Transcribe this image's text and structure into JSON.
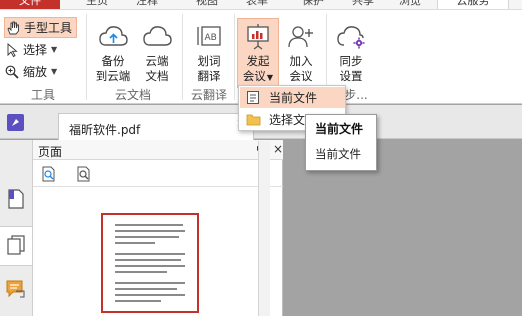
{
  "menu_tabs": {
    "file": "文件",
    "home": "主页",
    "comment": "注释",
    "view": "视图",
    "form": "表单",
    "protect": "保护",
    "share": "共享",
    "browse": "浏览",
    "cloud": "云服务"
  },
  "ribbon": {
    "hand_tool": "手型工具",
    "select": "选择",
    "zoom": "缩放",
    "tools_group": "工具",
    "backup_line1": "备份",
    "backup_line2": "到云端",
    "cloud_doc_line1": "云端",
    "cloud_doc_line2": "文档",
    "cloud_docs_group": "云文档",
    "translate_line1": "划词",
    "translate_line2": "翻译",
    "translate_group": "云翻译",
    "meeting_line1": "发起",
    "meeting_line2": "会议",
    "join_line1": "加入",
    "join_line2": "会议",
    "sync_line1": "同步",
    "sync_line2": "设置",
    "sync_group": "步..."
  },
  "document_tab": {
    "title": "福昕软件.pdf",
    "close_glyph": "×"
  },
  "page_panel": {
    "title": "页面",
    "collapse_glyph": "▸◂",
    "close_glyph": "×"
  },
  "dropdown": {
    "current_file": "当前文件",
    "select_file": "选择文件"
  },
  "tooltip": {
    "title": "当前文件",
    "description": "当前文件"
  },
  "colors": {
    "accent_red": "#c4312b",
    "highlight_orange": "#fbd7c3",
    "app_logo_purple": "#5b4fc2"
  }
}
